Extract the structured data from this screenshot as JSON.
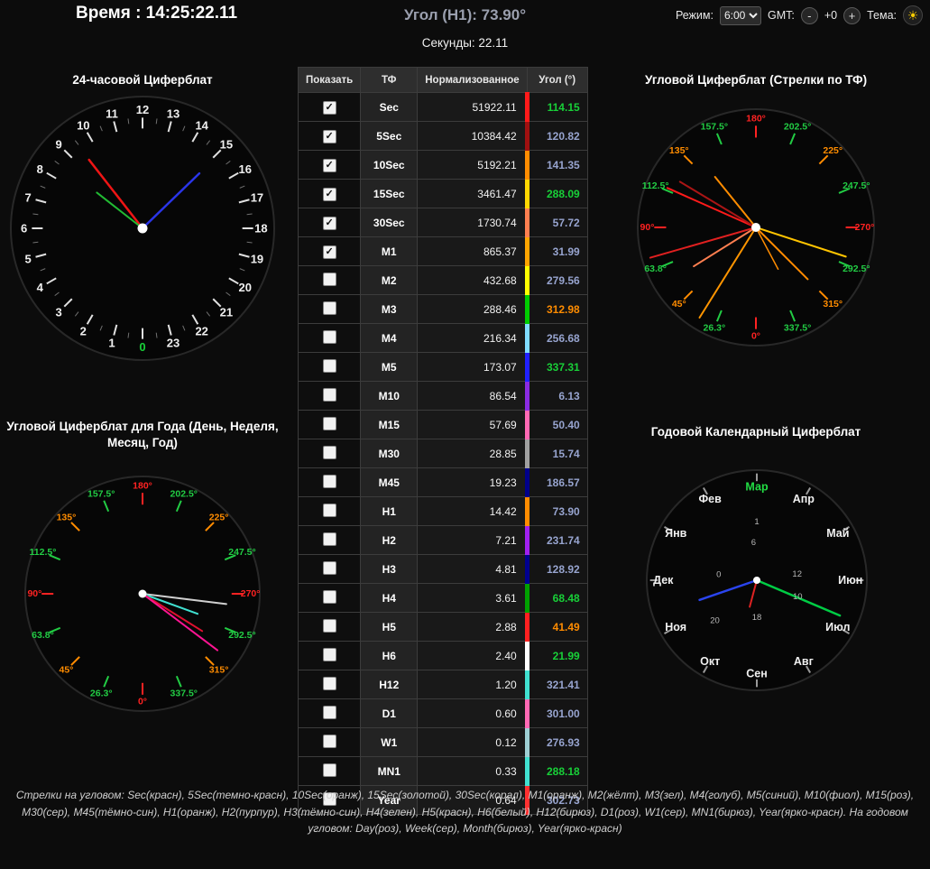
{
  "header": {
    "time": "Время : 14:25:22.11",
    "angle": "Угол (H1): 73.90°",
    "seconds": "Секунды: 22.11",
    "mode_label": "Режим:",
    "mode_value": "6:00",
    "gmt_label": "GMT:",
    "gmt_minus": "-",
    "gmt_offset": "+0",
    "gmt_plus": "+",
    "theme_label": "Тема:",
    "theme_icon": "☀"
  },
  "table": {
    "headers": [
      "Показать",
      "ТФ",
      "Нормализованное",
      "Угол (°)"
    ],
    "rows": [
      {
        "checked": true,
        "tf": "Sec",
        "normalized": "51922.11",
        "angle": "114.15",
        "angle_color": "#18d038",
        "stripe": "#ff1a1a"
      },
      {
        "checked": true,
        "tf": "5Sec",
        "normalized": "10384.42",
        "angle": "120.82",
        "angle_color": "#97a4cf",
        "stripe": "#a01010"
      },
      {
        "checked": true,
        "tf": "10Sec",
        "normalized": "5192.21",
        "angle": "141.35",
        "angle_color": "#97a4cf",
        "stripe": "#ff8c00"
      },
      {
        "checked": true,
        "tf": "15Sec",
        "normalized": "3461.47",
        "angle": "288.09",
        "angle_color": "#18d038",
        "stripe": "#ffd700"
      },
      {
        "checked": true,
        "tf": "30Sec",
        "normalized": "1730.74",
        "angle": "57.72",
        "angle_color": "#97a4cf",
        "stripe": "#ff7f50"
      },
      {
        "checked": true,
        "tf": "M1",
        "normalized": "865.37",
        "angle": "31.99",
        "angle_color": "#97a4cf",
        "stripe": "#ffa500"
      },
      {
        "checked": false,
        "tf": "M2",
        "normalized": "432.68",
        "angle": "279.56",
        "angle_color": "#97a4cf",
        "stripe": "#ffff00"
      },
      {
        "checked": false,
        "tf": "M3",
        "normalized": "288.46",
        "angle": "312.98",
        "angle_color": "#ff8c00",
        "stripe": "#00cc00"
      },
      {
        "checked": false,
        "tf": "M4",
        "normalized": "216.34",
        "angle": "256.68",
        "angle_color": "#97a4cf",
        "stripe": "#7fdcff"
      },
      {
        "checked": false,
        "tf": "M5",
        "normalized": "173.07",
        "angle": "337.31",
        "angle_color": "#18d038",
        "stripe": "#2020ff"
      },
      {
        "checked": false,
        "tf": "M10",
        "normalized": "86.54",
        "angle": "6.13",
        "angle_color": "#97a4cf",
        "stripe": "#8a2be2"
      },
      {
        "checked": false,
        "tf": "M15",
        "normalized": "57.69",
        "angle": "50.40",
        "angle_color": "#97a4cf",
        "stripe": "#ff69b4"
      },
      {
        "checked": false,
        "tf": "M30",
        "normalized": "28.85",
        "angle": "15.74",
        "angle_color": "#97a4cf",
        "stripe": "#a0a0a0"
      },
      {
        "checked": false,
        "tf": "M45",
        "normalized": "19.23",
        "angle": "186.57",
        "angle_color": "#97a4cf",
        "stripe": "#00008b"
      },
      {
        "checked": false,
        "tf": "H1",
        "normalized": "14.42",
        "angle": "73.90",
        "angle_color": "#97a4cf",
        "stripe": "#ff8c00"
      },
      {
        "checked": false,
        "tf": "H2",
        "normalized": "7.21",
        "angle": "231.74",
        "angle_color": "#97a4cf",
        "stripe": "#a020f0"
      },
      {
        "checked": false,
        "tf": "H3",
        "normalized": "4.81",
        "angle": "128.92",
        "angle_color": "#97a4cf",
        "stripe": "#000090"
      },
      {
        "checked": false,
        "tf": "H4",
        "normalized": "3.61",
        "angle": "68.48",
        "angle_color": "#18d038",
        "stripe": "#00a000"
      },
      {
        "checked": false,
        "tf": "H5",
        "normalized": "2.88",
        "angle": "41.49",
        "angle_color": "#ff8c00",
        "stripe": "#ff2020"
      },
      {
        "checked": false,
        "tf": "H6",
        "normalized": "2.40",
        "angle": "21.99",
        "angle_color": "#18d038",
        "stripe": "#ffffff"
      },
      {
        "checked": false,
        "tf": "H12",
        "normalized": "1.20",
        "angle": "321.41",
        "angle_color": "#97a4cf",
        "stripe": "#40e0d0"
      },
      {
        "checked": false,
        "tf": "D1",
        "normalized": "0.60",
        "angle": "301.00",
        "angle_color": "#97a4cf",
        "stripe": "#ff69b4"
      },
      {
        "checked": false,
        "tf": "W1",
        "normalized": "0.12",
        "angle": "276.93",
        "angle_color": "#97a4cf",
        "stripe": "#9ecfd4"
      },
      {
        "checked": false,
        "tf": "MN1",
        "normalized": "0.33",
        "angle": "288.18",
        "angle_color": "#18d038",
        "stripe": "#40e0d0"
      },
      {
        "checked": false,
        "tf": "Year",
        "normalized": "0.64",
        "angle": "302.73",
        "angle_color": "#97a4cf",
        "stripe": "#ff3030"
      }
    ]
  },
  "clocks": {
    "clock24": {
      "title": "24-часовой Циферблат",
      "labels": [
        {
          "text": "12",
          "angle": 0
        },
        {
          "text": "13",
          "angle": 15
        },
        {
          "text": "14",
          "angle": 30
        },
        {
          "text": "15",
          "angle": 45
        },
        {
          "text": "16",
          "angle": 60
        },
        {
          "text": "17",
          "angle": 75
        },
        {
          "text": "18",
          "angle": 90
        },
        {
          "text": "19",
          "angle": 105
        },
        {
          "text": "20",
          "angle": 120
        },
        {
          "text": "21",
          "angle": 135
        },
        {
          "text": "22",
          "angle": 150
        },
        {
          "text": "23",
          "angle": 165
        },
        {
          "text": "0",
          "angle": 180,
          "color": "#18d038"
        },
        {
          "text": "1",
          "angle": 195
        },
        {
          "text": "2",
          "angle": 210
        },
        {
          "text": "3",
          "angle": 225
        },
        {
          "text": "4",
          "angle": 240
        },
        {
          "text": "5",
          "angle": 255
        },
        {
          "text": "6",
          "angle": 270
        },
        {
          "text": "7",
          "angle": 285
        },
        {
          "text": "8",
          "angle": 300
        },
        {
          "text": "9",
          "angle": 315
        },
        {
          "text": "10",
          "angle": 330
        },
        {
          "text": "11",
          "angle": 345
        }
      ],
      "hands": [
        {
          "angle": 322,
          "len": 0.66,
          "color": "#ee1515",
          "width": 2.5
        },
        {
          "angle": 308,
          "len": 0.44,
          "color": "#22bb33",
          "width": 2
        },
        {
          "angle": 46,
          "len": 0.6,
          "color": "#2a35e8",
          "width": 2.5
        }
      ]
    },
    "angular_year": {
      "title": "Угловой Циферблат для Года (День, Неделя, Месяц, Год)",
      "labels": [
        {
          "text": "180°",
          "angle": 0,
          "color": "#ff2222"
        },
        {
          "text": "202.5°",
          "angle": 22.5,
          "color": "#22cc44"
        },
        {
          "text": "225°",
          "angle": 45,
          "color": "#ff8c00"
        },
        {
          "text": "247.5°",
          "angle": 67.5,
          "color": "#22cc44"
        },
        {
          "text": "270°",
          "angle": 90,
          "color": "#ff2222"
        },
        {
          "text": "292.5°",
          "angle": 112.5,
          "color": "#22cc44"
        },
        {
          "text": "315°",
          "angle": 135,
          "color": "#ff8c00"
        },
        {
          "text": "337.5°",
          "angle": 157.5,
          "color": "#22cc44"
        },
        {
          "text": "0°",
          "angle": 180,
          "color": "#ff2222"
        },
        {
          "text": "26.3°",
          "angle": 202.5,
          "color": "#22cc44"
        },
        {
          "text": "45°",
          "angle": 225,
          "color": "#ff8c00"
        },
        {
          "text": "63.8°",
          "angle": 247.5,
          "color": "#22cc44"
        },
        {
          "text": "90°",
          "angle": 270,
          "color": "#ff2222"
        },
        {
          "text": "112.5°",
          "angle": 292.5,
          "color": "#22cc44"
        },
        {
          "text": "135°",
          "angle": 315,
          "color": "#ff8c00"
        },
        {
          "text": "157.5°",
          "angle": 337.5,
          "color": "#22cc44"
        }
      ],
      "hands": [
        {
          "angle": 97,
          "len": 0.72,
          "color": "#cfcfcf",
          "width": 2
        },
        {
          "angle": 110,
          "len": 0.5,
          "color": "#40e0d0",
          "width": 2
        },
        {
          "angle": 122,
          "len": 0.6,
          "color": "#e01030",
          "width": 2
        },
        {
          "angle": 127,
          "len": 0.8,
          "color": "#ff1493",
          "width": 2
        }
      ]
    },
    "angular_tf": {
      "title": "Угловой Циферблат (Стрелки по ТФ)",
      "labels": [
        {
          "text": "180°",
          "angle": 0,
          "color": "#ff2222"
        },
        {
          "text": "202.5°",
          "angle": 22.5,
          "color": "#22cc44"
        },
        {
          "text": "225°",
          "angle": 45,
          "color": "#ff8c00"
        },
        {
          "text": "247.5°",
          "angle": 67.5,
          "color": "#22cc44"
        },
        {
          "text": "270°",
          "angle": 90,
          "color": "#ff2222"
        },
        {
          "text": "292.5°",
          "angle": 112.5,
          "color": "#22cc44"
        },
        {
          "text": "315°",
          "angle": 135,
          "color": "#ff8c00"
        },
        {
          "text": "337.5°",
          "angle": 157.5,
          "color": "#22cc44"
        },
        {
          "text": "0°",
          "angle": 180,
          "color": "#ff2222"
        },
        {
          "text": "26.3°",
          "angle": 202.5,
          "color": "#22cc44"
        },
        {
          "text": "45°",
          "angle": 225,
          "color": "#ff8c00"
        },
        {
          "text": "63.8°",
          "angle": 247.5,
          "color": "#22cc44"
        },
        {
          "text": "90°",
          "angle": 270,
          "color": "#ff2222"
        },
        {
          "text": "112.5°",
          "angle": 292.5,
          "color": "#22cc44"
        },
        {
          "text": "135°",
          "angle": 315,
          "color": "#ff8c00"
        },
        {
          "text": "157.5°",
          "angle": 337.5,
          "color": "#22cc44"
        }
      ],
      "hands": [
        {
          "angle": 294,
          "len": 0.82,
          "color": "#ff1a1a",
          "width": 2
        },
        {
          "angle": 301,
          "len": 0.75,
          "color": "#aa1515",
          "width": 2
        },
        {
          "angle": 321,
          "len": 0.55,
          "color": "#ff8c00",
          "width": 2
        },
        {
          "angle": 108,
          "len": 0.8,
          "color": "#ffc400",
          "width": 2
        },
        {
          "angle": 238,
          "len": 0.62,
          "color": "#ff7f50",
          "width": 2
        },
        {
          "angle": 212,
          "len": 0.9,
          "color": "#ff9500",
          "width": 2
        },
        {
          "angle": 254,
          "len": 0.93,
          "color": "#e02020",
          "width": 2
        },
        {
          "angle": 135,
          "len": 0.62,
          "color": "#ff8c00",
          "width": 2
        },
        {
          "angle": 152,
          "len": 0.4,
          "color": "#ff8c00",
          "width": 1.5
        }
      ]
    },
    "calendar_year": {
      "title": "Годовой Календарный Циферблат",
      "labels": [
        {
          "text": "Мар",
          "angle": 0,
          "color": "#22dd44"
        },
        {
          "text": "Апр",
          "angle": 30
        },
        {
          "text": "Май",
          "angle": 60
        },
        {
          "text": "Июн",
          "angle": 90
        },
        {
          "text": "Июл",
          "angle": 120
        },
        {
          "text": "Авг",
          "angle": 150
        },
        {
          "text": "Сен",
          "angle": 180
        },
        {
          "text": "Окт",
          "angle": 210
        },
        {
          "text": "Ноя",
          "angle": 240
        },
        {
          "text": "Дек",
          "angle": 270
        },
        {
          "text": "Янв",
          "angle": 300
        },
        {
          "text": "Фев",
          "angle": 330
        }
      ],
      "inner_labels": [
        {
          "text": "1",
          "angle": 0,
          "r": 0.53
        },
        {
          "text": "6",
          "angle": 355,
          "r": 0.34
        },
        {
          "text": "12",
          "angle": 82,
          "r": 0.37
        },
        {
          "text": "10",
          "angle": 112,
          "r": 0.4
        },
        {
          "text": "18",
          "angle": 180,
          "r": 0.34
        },
        {
          "text": "20",
          "angle": 226,
          "r": 0.53
        },
        {
          "text": "0",
          "angle": 278,
          "r": 0.35
        }
      ],
      "hands": [
        {
          "angle": 113,
          "len": 0.82,
          "color": "#00cc44",
          "width": 2.5
        },
        {
          "angle": 251,
          "len": 0.55,
          "color": "#2a44ee",
          "width": 2.5
        },
        {
          "angle": 195,
          "len": 0.25,
          "color": "#dd2222",
          "width": 2
        }
      ]
    }
  },
  "footer": {
    "legend": "Стрелки на угловом: Sec(красн), 5Sec(темно-красн), 10Sec(оранж), 15Sec(золотой), 30Sec(корал), M1(оранж), M2(жёлт), M3(зел), M4(голуб), M5(синий), M10(фиол), M15(роз), M30(сер), M45(тёмно-син), H1(оранж), H2(пурпур), H3(тёмно-син), H4(зелен), H5(красн), H6(белый), H12(бирюз), D1(роз), W1(сер), MN1(бирюз), Year(ярко-красн). На годовом угловом: Day(роз), Week(сер), Month(бирюз), Year(ярко-красн)"
  }
}
